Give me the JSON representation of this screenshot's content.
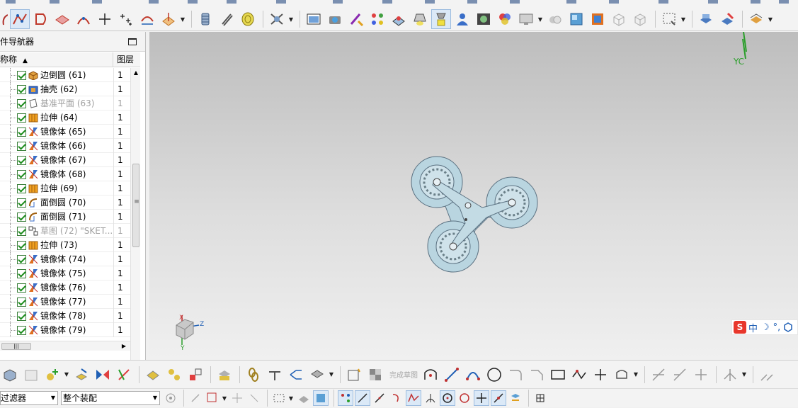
{
  "top_toolbar": {
    "tools": [
      "curve-icon",
      "studio-spline-icon",
      "sketch-icon",
      "surface-icon",
      "law-curve-icon",
      "point-icon",
      "point-set-icon",
      "extract-curve-icon",
      "datum-plane-icon",
      "spring-icon",
      "helix-icon",
      "thread-icon",
      "tube-icon",
      "render-icon",
      "camera-icon",
      "paint-icon",
      "cubes-icon",
      "scene-icon",
      "light-icon",
      "highlight-icon",
      "user-icon",
      "photo-icon",
      "palette-icon",
      "monitor-icon",
      "sphere-icon",
      "box-icon",
      "palette2-icon",
      "cube-outline-icon",
      "cube-outline2-icon",
      "select-box-icon",
      "view-icon",
      "edit-icon",
      "layer-icon"
    ]
  },
  "navigator": {
    "title": "件导航器",
    "col_name": "称称",
    "col_layer": "图层",
    "rows": [
      {
        "label": "边倒圆 (61)",
        "layer": "1",
        "icon": "edge-blend-icon",
        "dim": false
      },
      {
        "label": "抽壳 (62)",
        "layer": "1",
        "icon": "shell-icon",
        "dim": false
      },
      {
        "label": "基准平面 (63)",
        "layer": "1",
        "icon": "datum-plane-icon",
        "dim": true
      },
      {
        "label": "拉伸 (64)",
        "layer": "1",
        "icon": "extrude-icon",
        "dim": false
      },
      {
        "label": "镜像体 (65)",
        "layer": "1",
        "icon": "mirror-body-icon",
        "dim": false
      },
      {
        "label": "镜像体 (66)",
        "layer": "1",
        "icon": "mirror-body-icon",
        "dim": false
      },
      {
        "label": "镜像体 (67)",
        "layer": "1",
        "icon": "mirror-body-icon",
        "dim": false
      },
      {
        "label": "镜像体 (68)",
        "layer": "1",
        "icon": "mirror-body-icon",
        "dim": false
      },
      {
        "label": "拉伸 (69)",
        "layer": "1",
        "icon": "extrude-icon",
        "dim": false
      },
      {
        "label": "面倒圆 (70)",
        "layer": "1",
        "icon": "face-blend-icon",
        "dim": false
      },
      {
        "label": "面倒圆 (71)",
        "layer": "1",
        "icon": "face-blend-icon",
        "dim": false
      },
      {
        "label": "草图 (72) \"SKET...",
        "layer": "1",
        "icon": "sketch-icon",
        "dim": true
      },
      {
        "label": "拉伸 (73)",
        "layer": "1",
        "icon": "extrude-icon",
        "dim": false
      },
      {
        "label": "镜像体 (74)",
        "layer": "1",
        "icon": "mirror-body-icon",
        "dim": false
      },
      {
        "label": "镜像体 (75)",
        "layer": "1",
        "icon": "mirror-body-icon",
        "dim": false
      },
      {
        "label": "镜像体 (76)",
        "layer": "1",
        "icon": "mirror-body-icon",
        "dim": false
      },
      {
        "label": "镜像体 (77)",
        "layer": "1",
        "icon": "mirror-body-icon",
        "dim": false
      },
      {
        "label": "镜像体 (78)",
        "layer": "1",
        "icon": "mirror-body-icon",
        "dim": false
      },
      {
        "label": "镜像体 (79)",
        "layer": "1",
        "icon": "mirror-body-icon",
        "dim": false
      }
    ]
  },
  "viewport": {
    "yc_label": "YC",
    "triad": {
      "x": "X",
      "y": "Y",
      "z": "Z"
    },
    "ime": {
      "lang": "中",
      "moon": "☽",
      "dot": "°,"
    }
  },
  "bottom_toolbar": {
    "finish_sketch": "完成草图"
  },
  "statusbar": {
    "filter_value": "过滤器",
    "scope_value": "整个装配"
  },
  "colors": {
    "check_green": "#1c8c1c",
    "viewport_top": "#bdbdbd",
    "viewport_bottom": "#f0f0f0",
    "model_fill": "#b9d5e0",
    "yc_green": "#2a9e2a"
  }
}
